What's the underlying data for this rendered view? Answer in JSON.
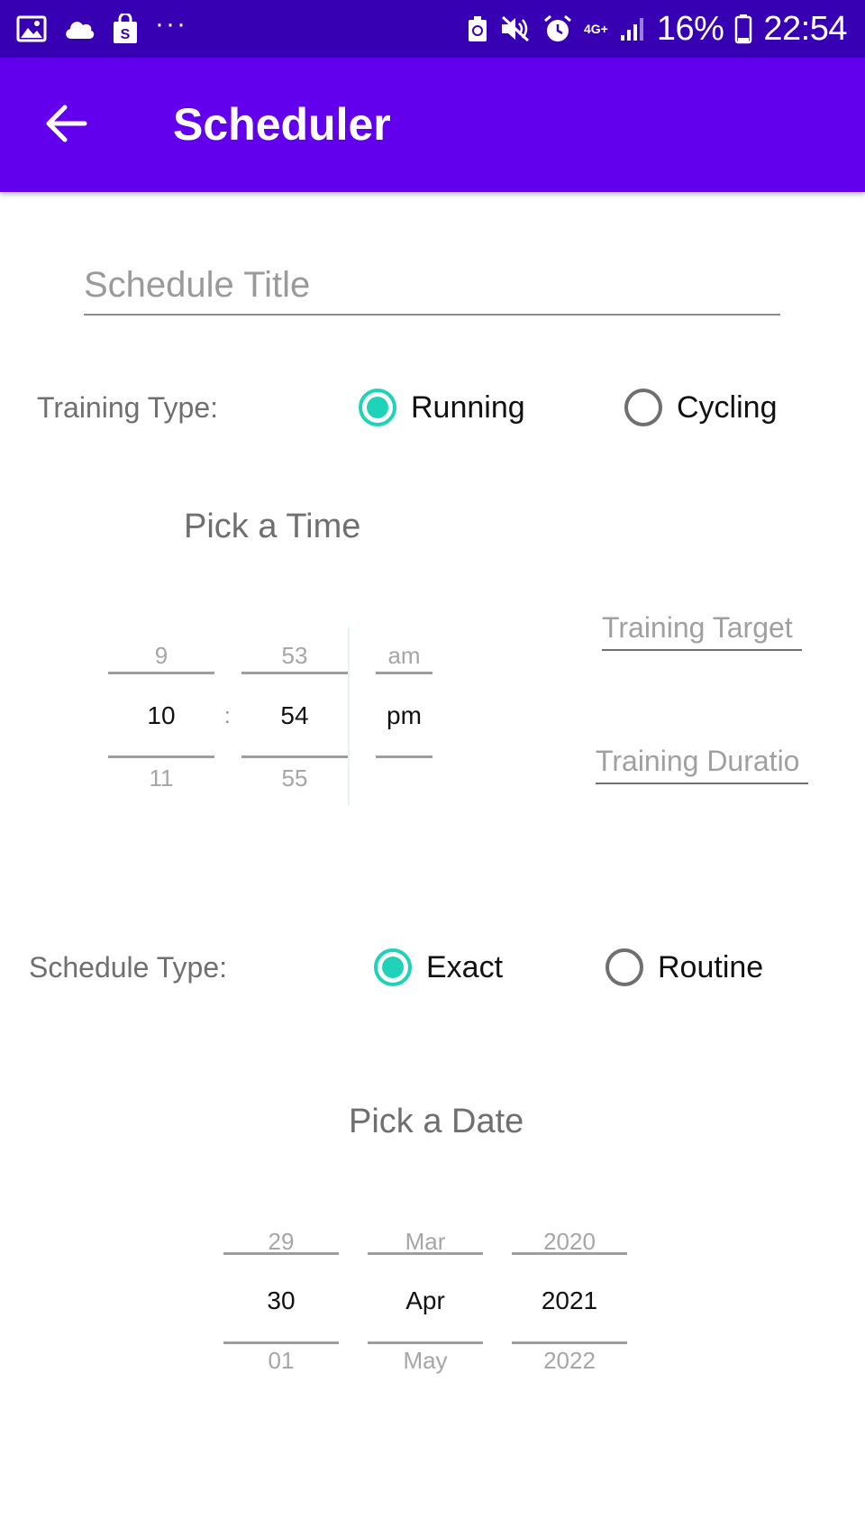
{
  "status_bar": {
    "dots": "···",
    "network": "4G+",
    "battery": "16%",
    "time": "22:54",
    "icons": [
      "gallery-icon",
      "cloud-icon",
      "shopping-bag-icon",
      "recycle-icon",
      "mute-icon",
      "alarm-icon",
      "signal-icon",
      "battery-icon"
    ]
  },
  "appbar": {
    "title": "Scheduler",
    "back_icon": "arrow-back-icon",
    "color": "#6200ee",
    "status_color": "#3700b3"
  },
  "schedule_title": {
    "placeholder": "Schedule Title",
    "value": ""
  },
  "training_type": {
    "label": "Training Type:",
    "options": [
      {
        "label": "Running",
        "selected": true
      },
      {
        "label": "Cycling",
        "selected": false
      }
    ]
  },
  "time_picker": {
    "title": "Pick a Time",
    "separator": ":",
    "hour": {
      "prev": "9",
      "current": "10",
      "next": "11"
    },
    "minute": {
      "prev": "53",
      "current": "54",
      "next": "55"
    },
    "ampm": {
      "prev": "am",
      "current": "pm",
      "next": ""
    }
  },
  "training_target": {
    "placeholder": "Training Target",
    "value": ""
  },
  "training_duration": {
    "placeholder": "Training Duratio",
    "value": ""
  },
  "schedule_type": {
    "label": "Schedule Type:",
    "options": [
      {
        "label": "Exact",
        "selected": true
      },
      {
        "label": "Routine",
        "selected": false
      }
    ]
  },
  "date_picker": {
    "title": "Pick a Date",
    "day": {
      "prev": "29",
      "current": "30",
      "next": "01"
    },
    "month": {
      "prev": "Mar",
      "current": "Apr",
      "next": "May"
    },
    "year": {
      "prev": "2020",
      "current": "2021",
      "next": "2022"
    }
  },
  "accent_color": "#1fd3b8"
}
